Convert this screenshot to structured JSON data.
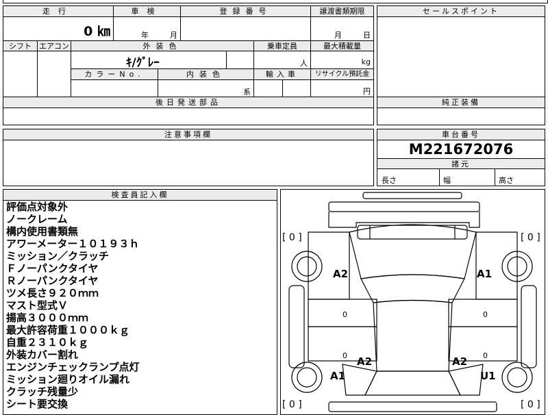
{
  "main_table": {
    "mileage_label": "走行",
    "mileage_value": "0 ㎞",
    "inspection_label": "車検",
    "inspection_year": "年",
    "inspection_month": "月",
    "registration_label": "登録番号",
    "transfer_label": "譲渡書類期限",
    "transfer_month": "月",
    "transfer_day": "日",
    "shift_label": "シフト",
    "aircon_label": "エアコン",
    "exterior_color_label": "外装色",
    "exterior_color_value": "ｷ/ｸﾞﾚｰ",
    "capacity_label": "乗車定員",
    "capacity_unit": "人",
    "max_load_label": "最大積載量",
    "max_load_unit": "kg",
    "color_no_label": "カラーNo.",
    "interior_color_label": "内装色",
    "interior_color_unit": "系",
    "import_label": "輸入車",
    "recycle_label": "リサイクル預託金",
    "recycle_unit": "円",
    "later_parts_label": "後日発送部品"
  },
  "sales_points": {
    "label": "セールスポイント"
  },
  "genuine_equipment": {
    "label": "純正装備"
  },
  "caution": {
    "label": "注意事項欄"
  },
  "chassis": {
    "label": "車台番号",
    "number": "M221672076",
    "dimensions_label": "諸元",
    "length_label": "長さ",
    "width_label": "幅",
    "height_label": "高さ"
  },
  "inspector": {
    "label": "検査員記入欄",
    "lines": [
      "評価点対象外",
      "ノークレーム",
      "構内使用書類無",
      "アワーメーター１０１９３ｈ",
      "ミッション／クラッチ",
      "Ｆノーパンクタイヤ",
      "Ｒノーパンクタイヤ",
      "ツメ長さ９２０ｍｍ",
      "マスト型式Ｖ",
      "揚高３０００ｍｍ",
      "最大許容荷重１０００ｋｇ",
      "自重２３１０ｋｇ",
      "外装カバー割れ",
      "エンジンチェックランプ点灯",
      "ミッション廻りオイル漏れ",
      "クラッチ残量少",
      "シート要交換"
    ]
  },
  "diagram": {
    "top_left_bracket": "[ 0 ]",
    "top_right_bracket": "[ 0 ]",
    "bottom_left_bracket": "[ 0 ]",
    "bottom_right_bracket": "[ 0 ]",
    "front_left_mark": "A2",
    "front_right_mark": "A1",
    "rear_left_mark": "A1",
    "rear_right_mark": "U1",
    "center_left_mark": "A2",
    "center_right_mark": "A2",
    "small_marks": [
      "0",
      "0",
      "0",
      "0"
    ]
  }
}
